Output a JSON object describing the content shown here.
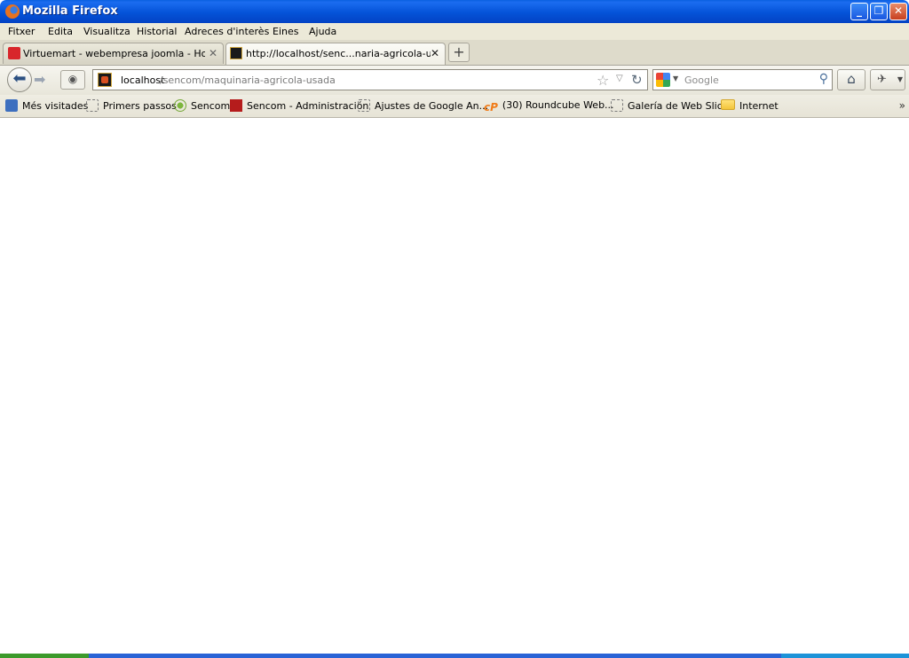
{
  "window": {
    "title": "Mozilla Firefox"
  },
  "menu": [
    "Fitxer",
    "Edita",
    "Visualitza",
    "Historial",
    "Adreces d'interès",
    "Eines",
    "Ajuda"
  ],
  "tabs": [
    {
      "label": "Virtuemart - webempresa joomla - Hostin...",
      "active": false
    },
    {
      "label": "http://localhost/senc...naria-agricola-usada",
      "active": true
    }
  ],
  "newtab_symbol": "+",
  "nav": {
    "url_host": "localhost",
    "url_path": "/sencom/maquinaria-agricola-usada",
    "search_placeholder": "Google"
  },
  "bookmarks": [
    {
      "label": "Més visitades",
      "icon": "most-visited-icon"
    },
    {
      "label": "Primers passos",
      "icon": "page-icon"
    },
    {
      "label": "Sencom",
      "icon": "sencom-icon"
    },
    {
      "label": "Sencom - Administración",
      "icon": "sencom-admin-icon"
    },
    {
      "label": "Ajustes de Google An...",
      "icon": "page-icon"
    },
    {
      "label": "(30) Roundcube Web...",
      "icon": "cpanel-icon"
    },
    {
      "label": "Galería de Web Slice",
      "icon": "page-icon"
    },
    {
      "label": "Internet",
      "icon": "folder-icon"
    }
  ],
  "bookmarks_overflow": "»",
  "colors": {
    "titlebar": "#0453d8",
    "chrome": "#ece9d8"
  }
}
